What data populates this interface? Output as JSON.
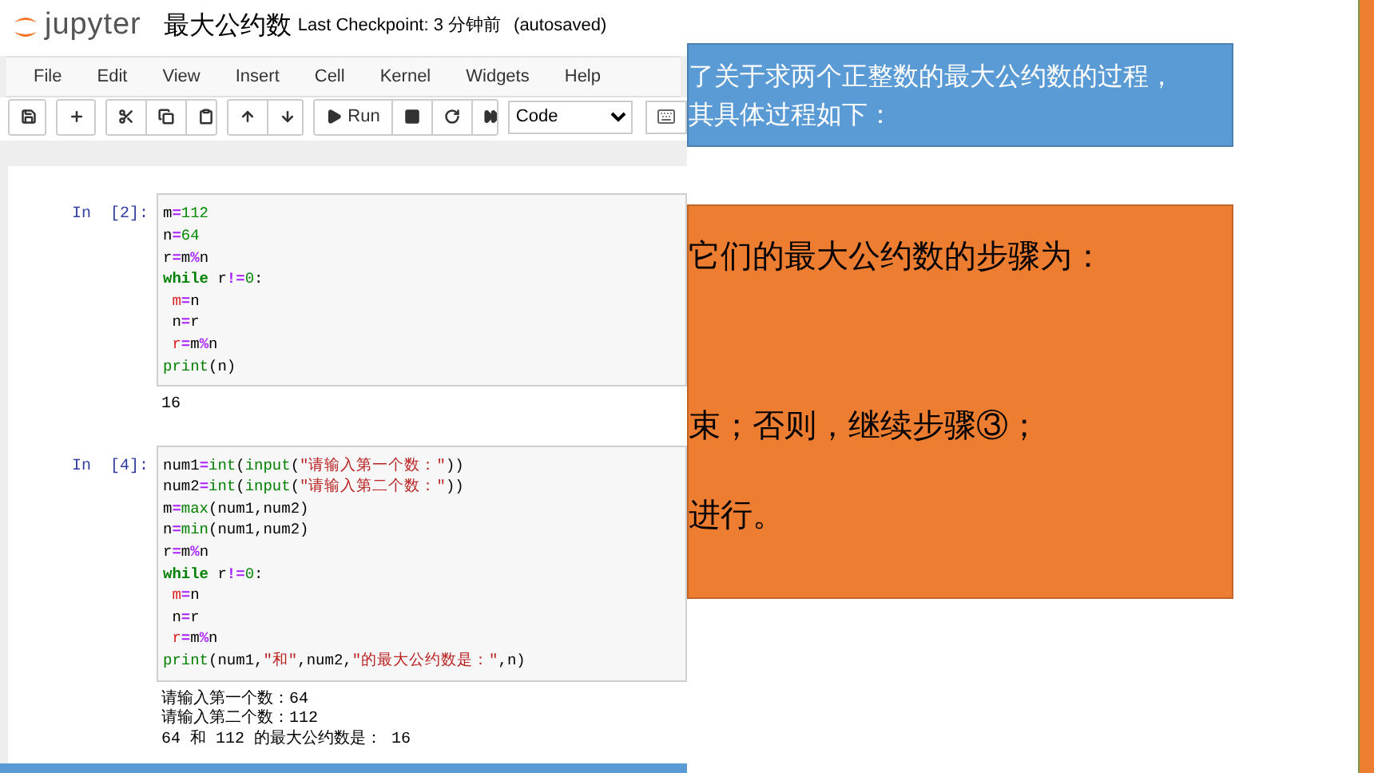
{
  "notebook": {
    "logo_text": "jupyter",
    "title": "最大公约数",
    "checkpoint": "Last Checkpoint: 3 分钟前",
    "autosave": "(autosaved)",
    "menu": [
      "File",
      "Edit",
      "View",
      "Insert",
      "Cell",
      "Kernel",
      "Widgets",
      "Help"
    ],
    "toolbar": [
      [
        {
          "kind": "save"
        }
      ],
      [
        {
          "kind": "add"
        }
      ],
      [
        {
          "kind": "cut"
        },
        {
          "kind": "copy"
        },
        {
          "kind": "paste"
        }
      ],
      [
        {
          "kind": "up"
        },
        {
          "kind": "down"
        }
      ],
      [
        {
          "kind": "run",
          "label": "Run"
        },
        {
          "kind": "stop"
        },
        {
          "kind": "restart"
        },
        {
          "kind": "forward"
        }
      ]
    ],
    "cell_type": "Code",
    "cells": [
      {
        "prompt": "In  [2]:",
        "lines": [
          [
            {
              "t": "m",
              "kind": "text"
            },
            {
              "t": "=",
              "kind": "op"
            },
            {
              "t": "112",
              "kind": "num"
            }
          ],
          [
            {
              "t": "n",
              "kind": "text"
            },
            {
              "t": "=",
              "kind": "op"
            },
            {
              "t": "64",
              "kind": "num"
            }
          ],
          [
            {
              "t": "r",
              "kind": "text"
            },
            {
              "t": "=",
              "kind": "op"
            },
            {
              "t": "m",
              "kind": "text"
            },
            {
              "t": "%",
              "kind": "op"
            },
            {
              "t": "n",
              "kind": "text"
            }
          ],
          [
            {
              "t": "while",
              "kind": "kw"
            },
            {
              "t": " r",
              "kind": "text"
            },
            {
              "t": "!=",
              "kind": "op"
            },
            {
              "t": "0",
              "kind": "num"
            },
            {
              "t": ":",
              "kind": "text"
            }
          ],
          [
            {
              "t": " m",
              "kind": "var"
            },
            {
              "t": "=",
              "kind": "op"
            },
            {
              "t": "n",
              "kind": "text"
            }
          ],
          [
            {
              "t": " n",
              "kind": "text"
            },
            {
              "t": "=",
              "kind": "op"
            },
            {
              "t": "r",
              "kind": "text"
            }
          ],
          [
            {
              "t": " r",
              "kind": "var"
            },
            {
              "t": "=",
              "kind": "op"
            },
            {
              "t": "m",
              "kind": "text"
            },
            {
              "t": "%",
              "kind": "op"
            },
            {
              "t": "n",
              "kind": "text"
            }
          ],
          [
            {
              "t": "print",
              "kind": "builtin"
            },
            {
              "t": "(n)",
              "kind": "text"
            }
          ]
        ],
        "output": [
          "16"
        ]
      },
      {
        "prompt": "In  [4]:",
        "lines": [
          [
            {
              "t": "num1",
              "kind": "text"
            },
            {
              "t": "=",
              "kind": "op"
            },
            {
              "t": "int",
              "kind": "builtin"
            },
            {
              "t": "(",
              "kind": "text"
            },
            {
              "t": "input",
              "kind": "builtin"
            },
            {
              "t": "(",
              "kind": "text"
            },
            {
              "t": "\"请输入第一个数：\"",
              "kind": "str"
            },
            {
              "t": "))",
              "kind": "text"
            }
          ],
          [
            {
              "t": "num2",
              "kind": "text"
            },
            {
              "t": "=",
              "kind": "op"
            },
            {
              "t": "int",
              "kind": "builtin"
            },
            {
              "t": "(",
              "kind": "text"
            },
            {
              "t": "input",
              "kind": "builtin"
            },
            {
              "t": "(",
              "kind": "text"
            },
            {
              "t": "\"请输入第二个数：\"",
              "kind": "str"
            },
            {
              "t": "))",
              "kind": "text"
            }
          ],
          [
            {
              "t": "m",
              "kind": "text"
            },
            {
              "t": "=",
              "kind": "op"
            },
            {
              "t": "max",
              "kind": "builtin"
            },
            {
              "t": "(num1,num2)",
              "kind": "text"
            }
          ],
          [
            {
              "t": "n",
              "kind": "text"
            },
            {
              "t": "=",
              "kind": "op"
            },
            {
              "t": "min",
              "kind": "builtin"
            },
            {
              "t": "(num1,num2)",
              "kind": "text"
            }
          ],
          [
            {
              "t": "r",
              "kind": "text"
            },
            {
              "t": "=",
              "kind": "op"
            },
            {
              "t": "m",
              "kind": "text"
            },
            {
              "t": "%",
              "kind": "op"
            },
            {
              "t": "n",
              "kind": "text"
            }
          ],
          [
            {
              "t": "while",
              "kind": "kw"
            },
            {
              "t": " r",
              "kind": "text"
            },
            {
              "t": "!=",
              "kind": "op"
            },
            {
              "t": "0",
              "kind": "num"
            },
            {
              "t": ":",
              "kind": "text"
            }
          ],
          [
            {
              "t": " m",
              "kind": "var"
            },
            {
              "t": "=",
              "kind": "op"
            },
            {
              "t": "n",
              "kind": "text"
            }
          ],
          [
            {
              "t": " n",
              "kind": "text"
            },
            {
              "t": "=",
              "kind": "op"
            },
            {
              "t": "r",
              "kind": "text"
            }
          ],
          [
            {
              "t": " r",
              "kind": "var"
            },
            {
              "t": "=",
              "kind": "op"
            },
            {
              "t": "m",
              "kind": "text"
            },
            {
              "t": "%",
              "kind": "op"
            },
            {
              "t": "n",
              "kind": "text"
            }
          ],
          [
            {
              "t": "print",
              "kind": "builtin"
            },
            {
              "t": "(num1,",
              "kind": "text"
            },
            {
              "t": "\"和\"",
              "kind": "str"
            },
            {
              "t": ",num2,",
              "kind": "text"
            },
            {
              "t": "\"的最大公约数是：\"",
              "kind": "str"
            },
            {
              "t": ",n)",
              "kind": "text"
            }
          ]
        ],
        "output": [
          "请输入第一个数：64",
          "请输入第二个数：112",
          "64 和 112 的最大公约数是： 16"
        ]
      }
    ]
  },
  "slide": {
    "blue_box": [
      "了关于求两个正整数的最大公约数的过程，",
      "其具体过程如下："
    ],
    "orange_box": [
      "它们的最大公约数的步骤为：",
      "束；否则，继续步骤③；",
      "进行。"
    ]
  }
}
